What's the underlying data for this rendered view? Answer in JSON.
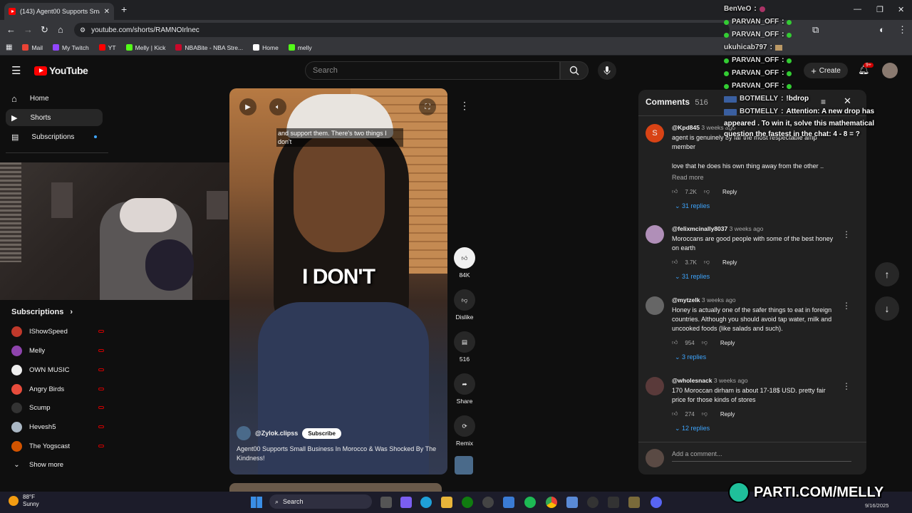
{
  "browser": {
    "tab_title": "(143) Agent00 Supports Small B",
    "url": "youtube.com/shorts/RAMNOIrlnec",
    "bookmarks": [
      {
        "label": "Mail",
        "color": "#ea4335"
      },
      {
        "label": "My Twitch",
        "color": "#9146ff"
      },
      {
        "label": "YT",
        "color": "#ff0000"
      },
      {
        "label": "Melly | Kick",
        "color": "#53fc18"
      },
      {
        "label": "NBABite - NBA Stre...",
        "color": "#c9082a"
      },
      {
        "label": "Home",
        "color": "#ffffff"
      },
      {
        "label": "melly",
        "color": "#53fc18"
      }
    ]
  },
  "youtube": {
    "logo_text": "YouTube",
    "search_placeholder": "Search",
    "create_label": "Create",
    "notif_count": "9+",
    "sidebar": [
      {
        "label": "Home",
        "icon": "home-icon"
      },
      {
        "label": "Shorts",
        "icon": "shorts-icon"
      },
      {
        "label": "Subscriptions",
        "icon": "subscriptions-icon"
      }
    ],
    "subscriptions_heading": "Subscriptions",
    "subscriptions": [
      {
        "label": "IShowSpeed",
        "color": "#c0392b"
      },
      {
        "label": "Melly",
        "color": "#8e44ad"
      },
      {
        "label": "OWN MUSIC",
        "color": "#eeeeee"
      },
      {
        "label": "Angry Birds",
        "color": "#e74c3c"
      },
      {
        "label": "Scump",
        "color": "#333333"
      },
      {
        "label": "Hevesh5",
        "color": "#aab7c4"
      },
      {
        "label": "The Yogscast",
        "color": "#d35400"
      }
    ],
    "show_more": "Show more"
  },
  "short": {
    "caption_top": "and support them. There's two things I don't",
    "caption_big": "I DON'T",
    "channel": "@Zylok.clipss",
    "subscribe": "Subscribe",
    "title": "Agent00 Supports Small Business In Morocco & Was Shocked By The Kindness!",
    "actions": {
      "likes": "84K",
      "dislike": "Dislike",
      "comments": "516",
      "share": "Share",
      "remix": "Remix"
    }
  },
  "comments": {
    "title": "Comments",
    "count": "516",
    "add_placeholder": "Add a comment...",
    "reply_label": "Reply",
    "items": [
      {
        "user": "@Kpd845",
        "time": "3 weeks ago",
        "text": "agent is genuinely by far the most respectable amp member",
        "text2": "love that he does his own thing away from the other ..",
        "read_more": "Read more",
        "likes": "7.2K",
        "replies": "31 replies",
        "avatar": "#d84315",
        "initial": "S"
      },
      {
        "user": "@felixmcinally8037",
        "time": "3 weeks ago",
        "text": "Moroccans are good people with some of the best honey on earth",
        "likes": "3.7K",
        "replies": "31 replies",
        "avatar": "#b08fb8"
      },
      {
        "user": "@mytzelk",
        "time": "3 weeks ago",
        "text": "Honey is actually one of the safer things to eat in foreign countries. Although you should avoid tap water, milk and uncooked foods (like salads and such).",
        "likes": "954",
        "replies": "3 replies",
        "avatar": "#666666"
      },
      {
        "user": "@wholesnack",
        "time": "3 weeks ago",
        "text": "170 Moroccan dirham is about 17-18$ USD. pretty fair price for those kinds of stores",
        "likes": "274",
        "replies": "12 replies",
        "avatar": "#5a3a3a"
      }
    ]
  },
  "chat": [
    {
      "user": "BenVeO",
      "msg": "",
      "type": "plain"
    },
    {
      "user": "PARVAN_OFF",
      "msg": "",
      "type": "dot"
    },
    {
      "user": "PARVAN_OFF",
      "msg": "",
      "type": "dot"
    },
    {
      "user": "ukuhicab797",
      "msg": "",
      "type": "plain"
    },
    {
      "user": "PARVAN_OFF",
      "msg": "",
      "type": "dot"
    },
    {
      "user": "PARVAN_OFF",
      "msg": "",
      "type": "dot"
    },
    {
      "user": "PARVAN_OFF",
      "msg": "",
      "type": "dot"
    },
    {
      "user": "BOTMELLY",
      "msg": "!bdrop",
      "type": "bot"
    },
    {
      "user": "BOTMELLY",
      "msg": "Attention: A new drop has",
      "type": "bot"
    }
  ],
  "chat_cont": "appeared . To win it, solve this mathematical question the fastest in the chat: 4 - 8 = ?",
  "taskbar": {
    "weather_temp": "88°F",
    "weather_desc": "Sunny",
    "search": "Search",
    "date": "9/16/2025"
  },
  "overlay": {
    "brand": "PARTI.COM/MELLY"
  }
}
